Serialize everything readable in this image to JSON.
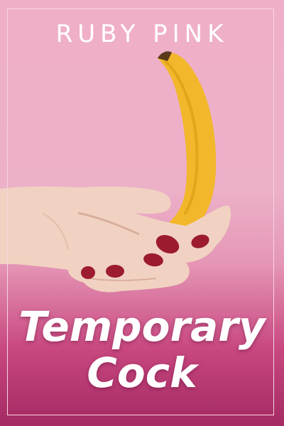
{
  "cover": {
    "author": "RUBY PINK",
    "title_line_1": "Temporary",
    "title_line_2": "Cock"
  },
  "colors": {
    "background_top": "#f0afc8",
    "background_bottom": "#a42a63",
    "frame": "#f6d4e2",
    "text": "#ffffff",
    "banana": "#f2b72a",
    "nail_polish": "#9c1b2e"
  }
}
